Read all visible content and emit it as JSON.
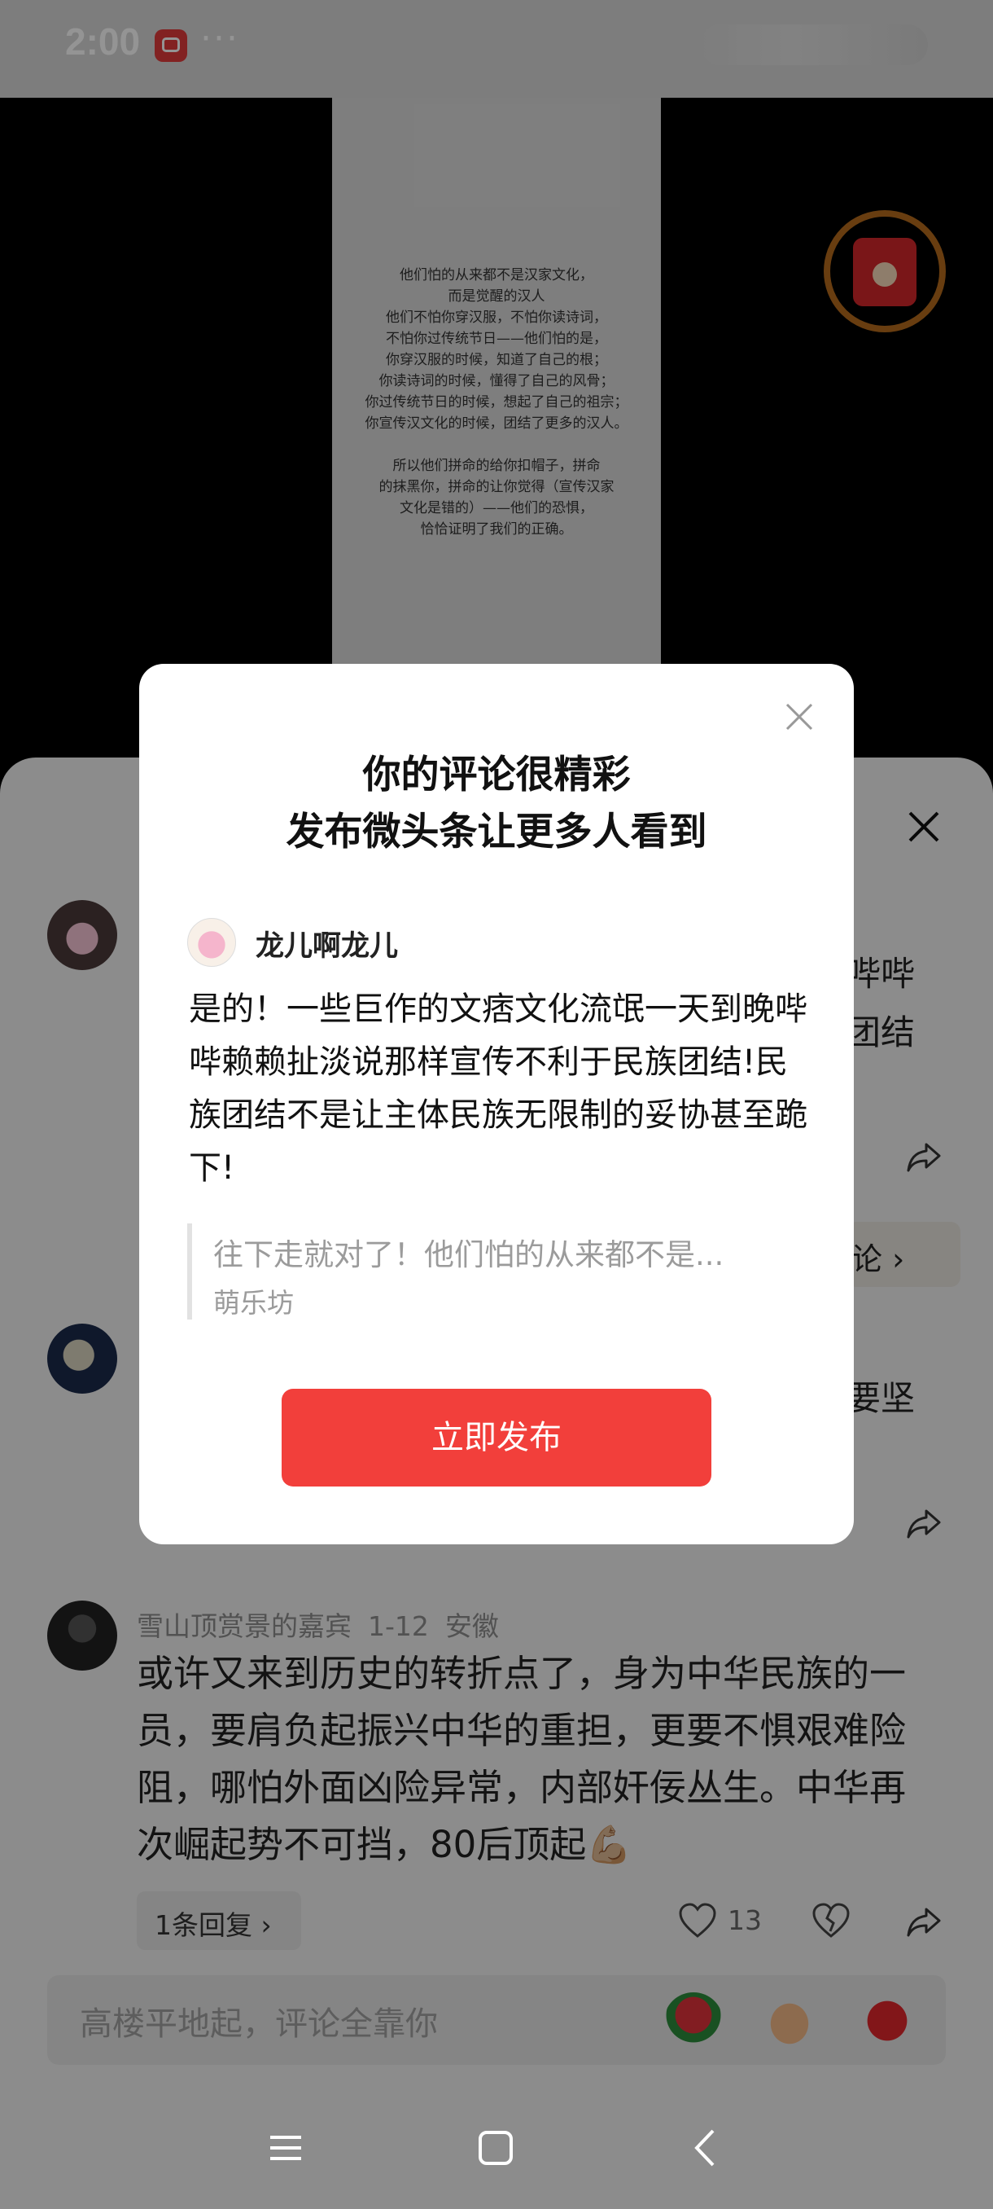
{
  "status_bar": {
    "time": "2:00",
    "more": "···"
  },
  "video": {
    "text": "他们怕的从来都不是汉家文化，\n而是觉醒的汉人\n他们不怕你穿汉服，不怕你读诗词，\n不怕你过传统节日——他们怕的是，\n你穿汉服的时候，知道了自己的根；\n你读诗词的时候，懂得了自己的风骨；\n你过传统节日的时候，想起了自己的祖宗；\n你宣传汉文化的时候，团结了更多的汉人。\n\n所以他们拼命的给你扣帽子，拼命\n的抹黑你，拼命的让你觉得（宣传汉家\n文化是错的）——他们的恐惧，\n恰恰证明了我们的正确。"
  },
  "comments": {
    "c1": {
      "right_line1": "哔哔",
      "right_line2": "团结",
      "reply_fragment": "论 ›"
    },
    "c2": {
      "right_line1": "要坚"
    },
    "c3": {
      "author": "雪山顶赏景的嘉宾",
      "date": "1-12",
      "location": "安徽",
      "text": "或许又来到历史的转折点了，身为中华民族的一员，要肩负起振兴中华的重担，更要不惧艰难险阻，哪怕外面凶险异常，内部奸佞丛生。中华再次崛起势不可挡，80后顶起💪🏼",
      "replies": "1条回复 ›",
      "likes": "13"
    }
  },
  "input_bar": {
    "placeholder": "高楼平地起，评论全靠你"
  },
  "modal": {
    "title_line1": "你的评论很精彩",
    "title_line2": "发布微头条让更多人看到",
    "username": "龙儿啊龙儿",
    "comment": "是的！一些巨作的文痞文化流氓一天到晚哔哔赖赖扯淡说那样宣传不利于民族团结!民族团结不是让主体民族无限制的妥协甚至跪下!",
    "quote_text": "往下走就对了！他们怕的从来都不是...",
    "quote_author": "萌乐坊",
    "publish_label": "立即发布"
  },
  "colors": {
    "accent": "#f23f3b",
    "overlay": "rgba(0,0,0,0.42)"
  }
}
